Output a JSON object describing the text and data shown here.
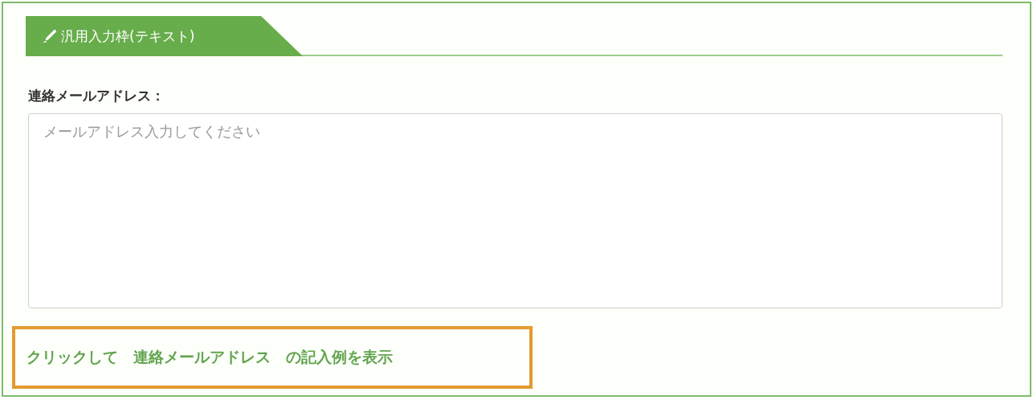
{
  "section_tab": {
    "title": "汎用入力枠(テキスト)"
  },
  "field": {
    "label": "連絡メールアドレス：",
    "placeholder": "メールアドレス入力してください"
  },
  "example_link": {
    "text": "クリックして　連絡メールアドレス　の記入例を表示",
    "highlighted": true
  }
}
